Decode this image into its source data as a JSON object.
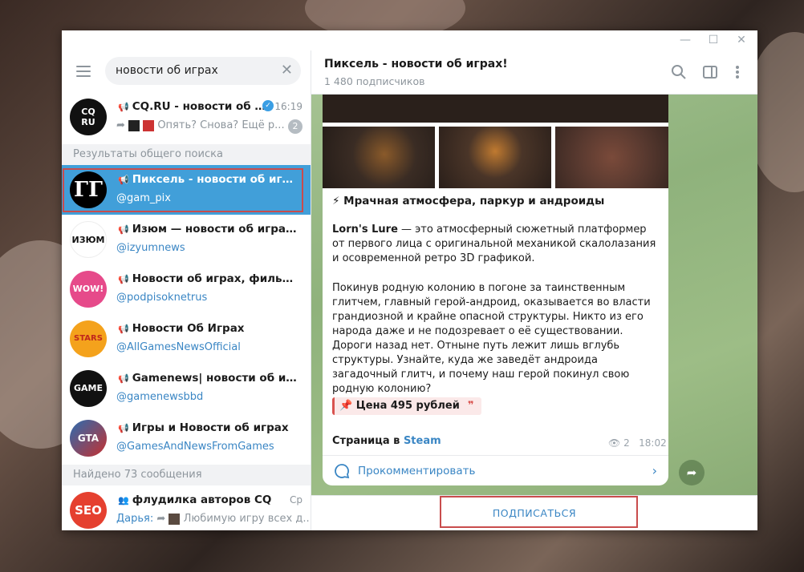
{
  "window": {
    "minimize": "—",
    "maximize": "☐",
    "close": "✕"
  },
  "search": {
    "value": "новости об играх"
  },
  "top_chat": {
    "title": "CQ.RU - новости об и...",
    "time": "16:19",
    "preview": "Опять? Снова? Ещё р...",
    "unread": "2",
    "avatar_text": "CQ RU"
  },
  "sections": {
    "global": "Результаты общего поиска",
    "found": "Найдено 73 сообщения"
  },
  "results": [
    {
      "title": "Пиксель - новости об играх!",
      "handle": "@gam_pix",
      "avatar_text": "ГГ"
    },
    {
      "title": "Изюм — новости об играх, кин...",
      "handle": "@izyumnews",
      "avatar_text": "ИЗЮМ"
    },
    {
      "title": "Новости об играх, фильмах и ...",
      "handle": "@podpisoknetrus",
      "avatar_text": "WOW!"
    },
    {
      "title": "Новости Об Играх",
      "handle": "@AllGamesNewsOfficial",
      "avatar_text": "STARS"
    },
    {
      "title": "Gamenews| новости об играх",
      "handle": "@gamenewsbbd",
      "avatar_text": "GAME"
    },
    {
      "title": "Игры и Новости об играх",
      "handle": "@GamesAndNewsFromGames",
      "avatar_text": "GTA"
    }
  ],
  "message_result": {
    "title": "флудилка авторов CQ",
    "time": "Ср",
    "preview": "Дарья:",
    "preview2": "Любимую игру всех д...",
    "avatar_text": "SEO"
  },
  "channel": {
    "title": "Пиксель - новости об играх!",
    "subscribers": "1 480 подписчиков"
  },
  "post": {
    "heading": "⚡ Мрачная атмосфера, паркур и андроиды",
    "p1_bold": "Lorn's Lure",
    "p1": " — это атмосферный сюжетный платформер от первого лица с оригинальной механикой скалолазания и осовременной ретро 3D графикой.",
    "p2": "Покинув родную колонию в погоне за таинственным глитчем, главный герой-андроид, оказывается во власти грандиозной и крайне опасной структуры. Никто из его народа даже и не подозревает о её существовании. Дороги назад нет. Отныне путь лежит лишь вглубь структуры. Узнайте, куда же заведёт андроида загадочный глитч, и почему наш герой покинул свою родную колонию?",
    "price": "📌 Цена 495 рублей",
    "price_quote": "❞",
    "steam_prefix": "Страница в ",
    "steam_link": "Steam",
    "views": "2",
    "time": "18:02",
    "comment": "Прокомментировать"
  },
  "subscribe": "ПОДПИСАТЬСЯ"
}
